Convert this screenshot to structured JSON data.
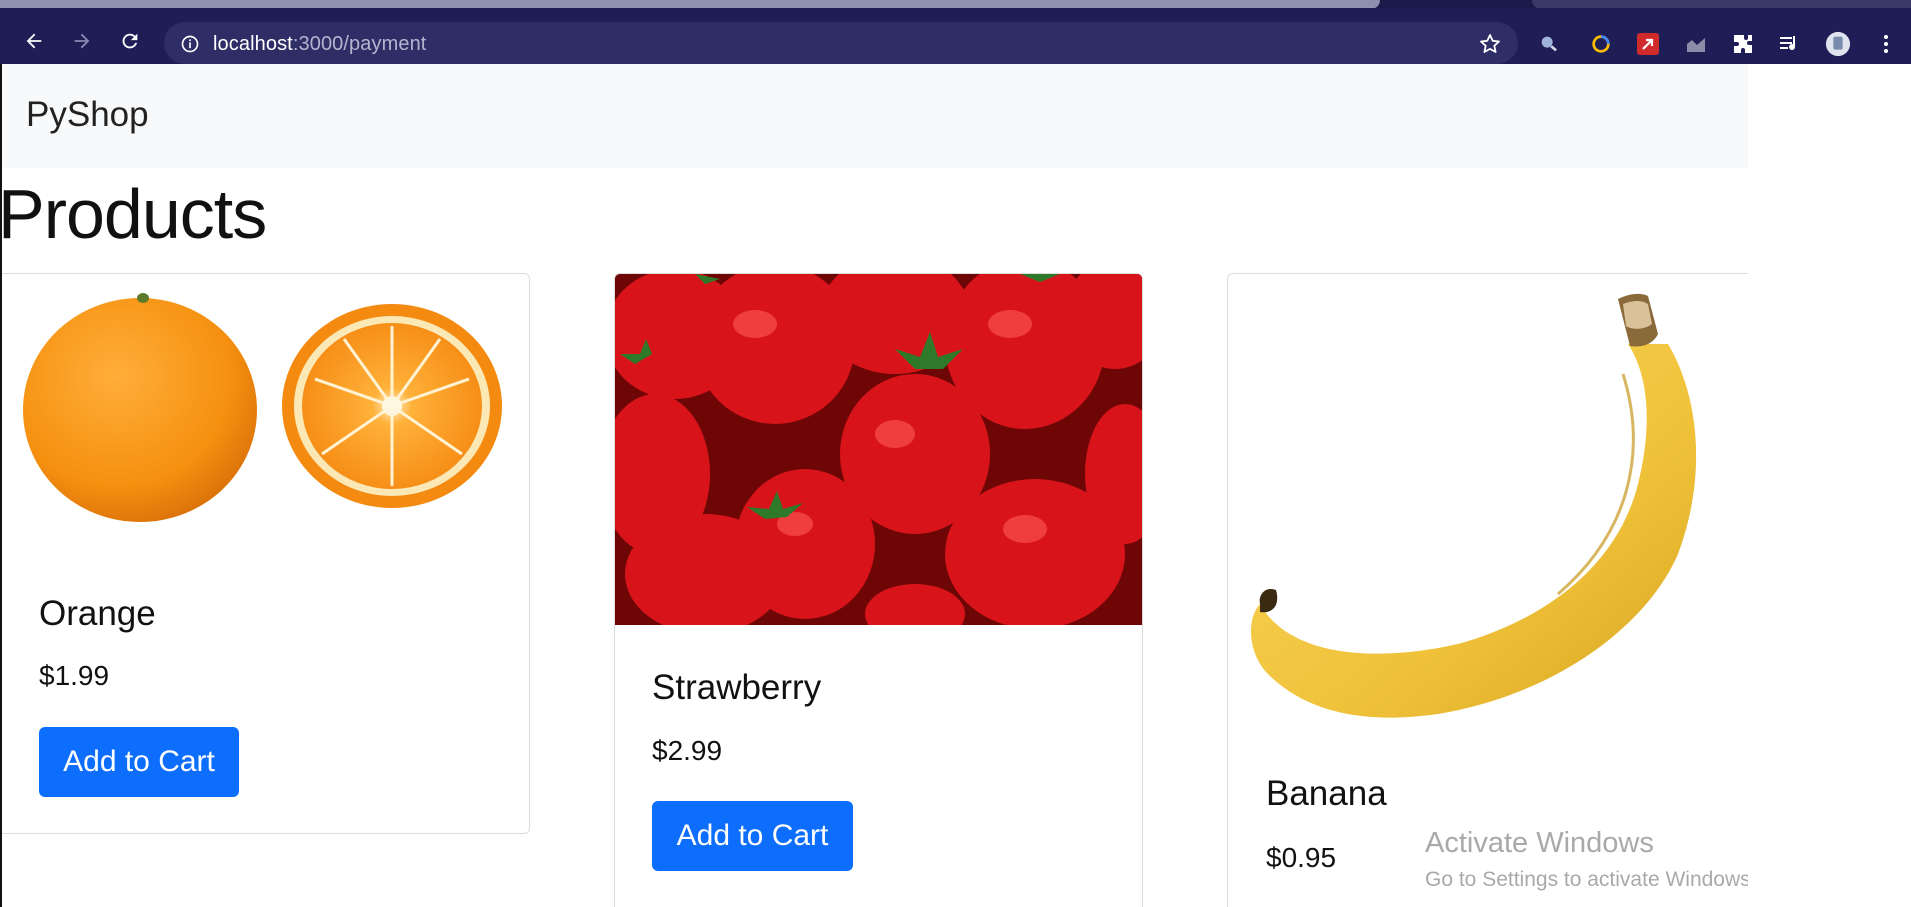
{
  "browser": {
    "url_host": "localhost",
    "url_path": ":3000/payment"
  },
  "icons": {
    "back": "back-arrow-icon",
    "forward": "forward-arrow-icon",
    "reload": "reload-icon",
    "info": "info-icon",
    "bookmark": "star-icon",
    "menu": "kebab-menu-icon"
  },
  "navbar": {
    "brand": "PyShop"
  },
  "main": {
    "heading": "Products",
    "products": [
      {
        "name": "Orange",
        "price": "$1.99",
        "button": "Add to Cart"
      },
      {
        "name": "Strawberry",
        "price": "$2.99",
        "button": "Add to Cart"
      },
      {
        "name": "Banana",
        "price": "$0.95"
      }
    ]
  },
  "overlay": {
    "line1": "Activate Windows",
    "line2": "Go to Settings to activate Windows."
  },
  "colors": {
    "chrome_bg": "#1f1d56",
    "omnibox_bg": "#2f2d66",
    "navbar_bg": "#f8f9fa",
    "button_bg": "#0d6efd"
  }
}
